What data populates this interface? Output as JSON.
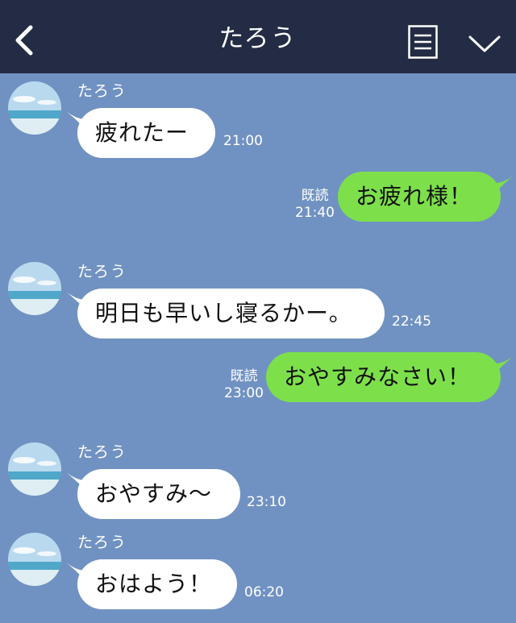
{
  "header": {
    "title": "たろう"
  },
  "colors": {
    "header_bg": "#232c44",
    "chat_bg": "#7092c2",
    "incoming_bubble": "#ffffff",
    "outgoing_bubble": "#7de04b"
  },
  "icons": {
    "back": "back-icon",
    "menu": "menu-icon",
    "collapse": "chevron-down-icon",
    "avatar": "beach-avatar"
  },
  "messages": [
    {
      "direction": "incoming",
      "sender": "たろう",
      "text": "疲れたー",
      "time": "21:00"
    },
    {
      "direction": "outgoing",
      "read": "既読",
      "text": "お疲れ様！",
      "time": "21:40"
    },
    {
      "direction": "incoming",
      "sender": "たろう",
      "text": "明日も早いし寝るかー。",
      "time": "22:45"
    },
    {
      "direction": "outgoing",
      "read": "既読",
      "text": "おやすみなさい！",
      "time": "23:00"
    },
    {
      "direction": "incoming",
      "sender": "たろう",
      "text": "おやすみ〜",
      "time": "23:10"
    },
    {
      "direction": "incoming",
      "sender": "たろう",
      "text": "おはよう！",
      "time": "06:20"
    }
  ]
}
